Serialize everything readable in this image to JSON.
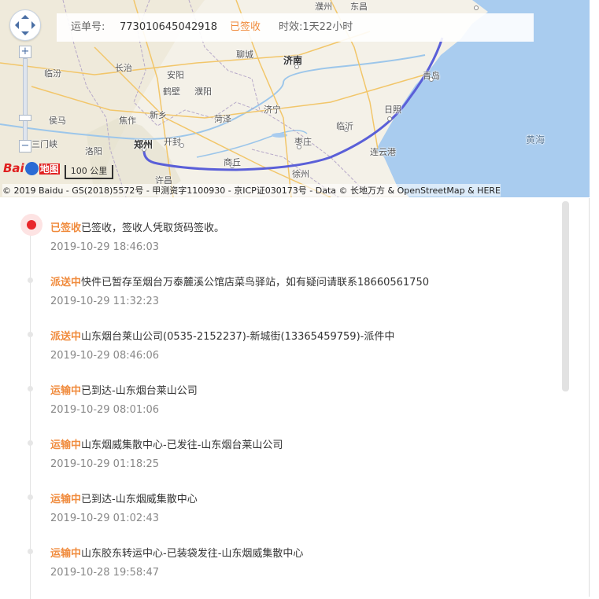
{
  "map": {
    "info_bar": {
      "waybill_label": "运单号:",
      "waybill_number": "773010645042918",
      "status": "已签收",
      "duration": "时效:1天22小时"
    },
    "cities": [
      "濮州",
      "东昌",
      "临汾",
      "长治",
      "聊城",
      "济南",
      "安阳",
      "鹤壁",
      "濮阳",
      "青岛",
      "济宁",
      "日照",
      "焦作",
      "新乡",
      "菏泽",
      "临沂",
      "黄海",
      "侯马",
      "郑州",
      "开封",
      "枣庄",
      "连云港",
      "洛阳",
      "商丘",
      "徐州",
      "许昌",
      "三门峡"
    ],
    "logo_text": "Bai",
    "logo_suffix": "地图",
    "scale_label": "100 公里",
    "copyright": "© 2019 Baidu - GS(2018)5572号 - 甲测资字1100930 - 京ICP证030173号 - Data © 长地万方 & OpenStreetMap & HERE",
    "controls": {
      "zoom_in": "+",
      "zoom_out": "−"
    },
    "colors": {
      "route": "#5a5fd8",
      "sea": "#a9ccef",
      "land": "#f4f1e8"
    }
  },
  "timeline": {
    "events": [
      {
        "status": "已签收",
        "text": "已签收，签收人凭取货码签收。",
        "time": "2019-10-29 18:46:03"
      },
      {
        "status": "派送中",
        "text": "快件已暂存至烟台万泰麓溪公馆店菜鸟驿站，如有疑问请联系18660561750",
        "time": "2019-10-29 11:32:23"
      },
      {
        "status": "派送中",
        "text": "山东烟台莱山公司(0535-2152237)-新城街(13365459759)-派件中",
        "time": "2019-10-29 08:46:06"
      },
      {
        "status": "运输中",
        "text": "已到达-山东烟台莱山公司",
        "time": "2019-10-29 08:01:06"
      },
      {
        "status": "运输中",
        "text": "山东烟威集散中心-已发往-山东烟台莱山公司",
        "time": "2019-10-29 01:18:25"
      },
      {
        "status": "运输中",
        "text": "已到达-山东烟威集散中心",
        "time": "2019-10-29 01:02:43"
      },
      {
        "status": "运输中",
        "text": "山东胶东转运中心-已装袋发往-山东烟威集散中心",
        "time": "2019-10-28 19:58:47"
      }
    ],
    "status_color": "#f08b3d",
    "current_dot_color": "#e8272b"
  }
}
